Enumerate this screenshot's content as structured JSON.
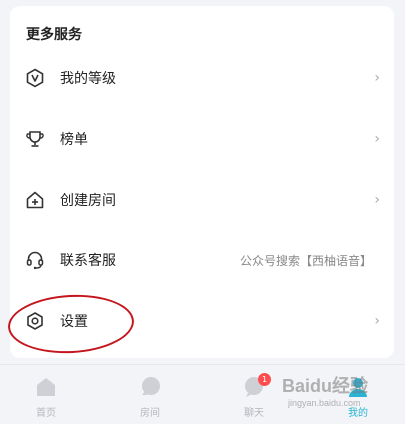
{
  "section": {
    "title": "更多服务"
  },
  "menu": [
    {
      "label": "我的等级",
      "icon": "level-v-icon",
      "extra": "",
      "chevron": "›"
    },
    {
      "label": "榜单",
      "icon": "trophy-icon",
      "extra": "",
      "chevron": "›"
    },
    {
      "label": "创建房间",
      "icon": "create-room-icon",
      "extra": "",
      "chevron": "›"
    },
    {
      "label": "联系客服",
      "icon": "headset-icon",
      "extra": "公众号搜索【西柚语音】",
      "chevron": "›"
    },
    {
      "label": "设置",
      "icon": "settings-icon",
      "extra": "",
      "chevron": "›"
    }
  ],
  "tabs": [
    {
      "label": "首页",
      "icon": "home-icon",
      "active": false
    },
    {
      "label": "房间",
      "icon": "room-icon",
      "active": false
    },
    {
      "label": "聊天",
      "icon": "chat-icon",
      "active": false,
      "badge": "1"
    },
    {
      "label": "我的",
      "icon": "profile-icon",
      "active": true
    }
  ],
  "watermark": {
    "text": "Baidu经验",
    "sub": "jingyan.baidu.com"
  },
  "colors": {
    "accent": "#2bb3d6",
    "annotation": "#c4161c",
    "badge": "#ff4d4f"
  }
}
